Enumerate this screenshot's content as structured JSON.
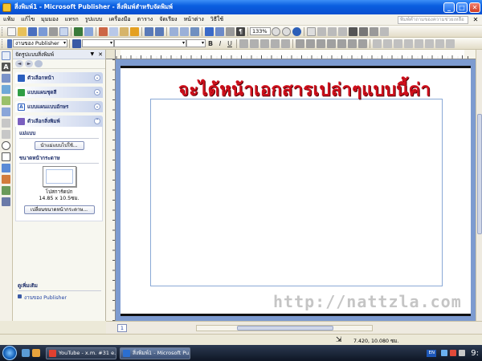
{
  "window": {
    "title": "สิ่งพิมพ์1 - Microsoft Publisher - สิ่งพิมพ์สำหรับจัดพิมพ์",
    "minimize": "_",
    "maximize": "□",
    "close": "✕"
  },
  "menu": {
    "items": [
      "แฟ้ม",
      "แก้ไข",
      "มุมมอง",
      "แทรก",
      "รูปแบบ",
      "เครื่องมือ",
      "ตาราง",
      "จัดเรียง",
      "หน้าต่าง",
      "วิธีใช้"
    ],
    "help_placeholder": "พิมพ์คำถามของความช่วยเหลือ",
    "close": "✕"
  },
  "toolbar": {
    "zoom": "133%",
    "style_box": "งานของ Publisher",
    "bold": "B",
    "italic": "I",
    "underline": "U"
  },
  "task_pane": {
    "title": "จัดรูปแบบสิ่งพิมพ์",
    "back": "◄",
    "forward": "►",
    "close": "✕",
    "sections": [
      {
        "label": "ตัวเลือกหน้า",
        "icon": "page-options-icon",
        "chevron": "¥",
        "color": "#2b5fbf"
      },
      {
        "label": "แบบแผนชุดสี",
        "icon": "color-scheme-icon",
        "chevron": "¥",
        "color": "#2f9e44"
      },
      {
        "label": "แบบแผนแบบอักษร",
        "icon": "font-scheme-icon",
        "chevron": "¥",
        "color": "#2b5fbf"
      },
      {
        "label": "ตัวเลือกสิ่งพิมพ์",
        "icon": "publication-options-icon",
        "chevron": "«",
        "color": "#7a5fbf"
      }
    ],
    "template_label": "แม่แบบ",
    "apply_template_button": "นำแม่แบบไปใช้...",
    "paper_size_label": "ขนาดหน้ากระดาษ",
    "paper_name": "โปสการ์ดปก",
    "paper_dims": "14.85 x 10.5ซม.",
    "change_paper_button": "เปลี่ยนขนาดหน้ากระดาษ...",
    "more_label": "ดูเพิ่มเติม",
    "publisher_tasks_link": "งานของ Publisher"
  },
  "document": {
    "overlay_text": "จะได้หน้าเอกสารเปล่าๆแบบนี้ค่า",
    "watermark": "http://nattzla.com",
    "page_tab": "1"
  },
  "status": {
    "coordinates": "7.420, 10.080 ซม."
  },
  "taskbar": {
    "tasks": [
      "YouTube - x.m. #31 e...",
      "สิ่งพิมพ์1 - Microsoft Pu..."
    ],
    "language": "EN",
    "clock": "9:"
  }
}
